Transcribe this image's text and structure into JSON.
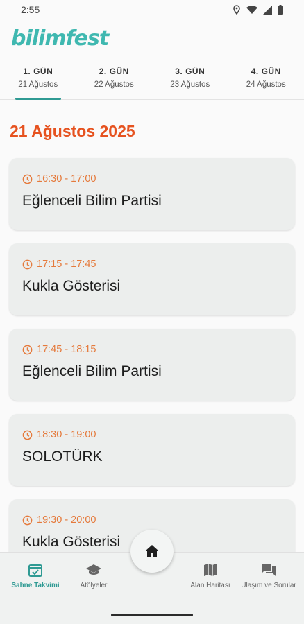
{
  "status": {
    "time": "2:55"
  },
  "logo": {
    "text": "bilimfest"
  },
  "tabs": [
    {
      "day": "1. GÜN",
      "date": "21 Ağustos"
    },
    {
      "day": "2. GÜN",
      "date": "22 Ağustos"
    },
    {
      "day": "3. GÜN",
      "date": "23 Ağustos"
    },
    {
      "day": "4. GÜN",
      "date": "24 Ağustos"
    }
  ],
  "selected_date": "21 Ağustos 2025",
  "events": [
    {
      "time": "16:30 - 17:00",
      "title": "Eğlenceli Bilim Partisi"
    },
    {
      "time": "17:15 - 17:45",
      "title": "Kukla Gösterisi"
    },
    {
      "time": "17:45 - 18:15",
      "title": "Eğlenceli Bilim Partisi"
    },
    {
      "time": "18:30 - 19:00",
      "title": "SOLOTÜRK"
    },
    {
      "time": "19:30 - 20:00",
      "title": "Kukla Gösterisi"
    }
  ],
  "bottom_nav": {
    "schedule": "Sahne Takvimi",
    "workshops": "Atölyeler",
    "map": "Alan Haritası",
    "transport": "Ulaşım ve Sorular"
  },
  "colors": {
    "accent": "#2f9a93",
    "date": "#e6521f",
    "time": "#e57a3c"
  }
}
